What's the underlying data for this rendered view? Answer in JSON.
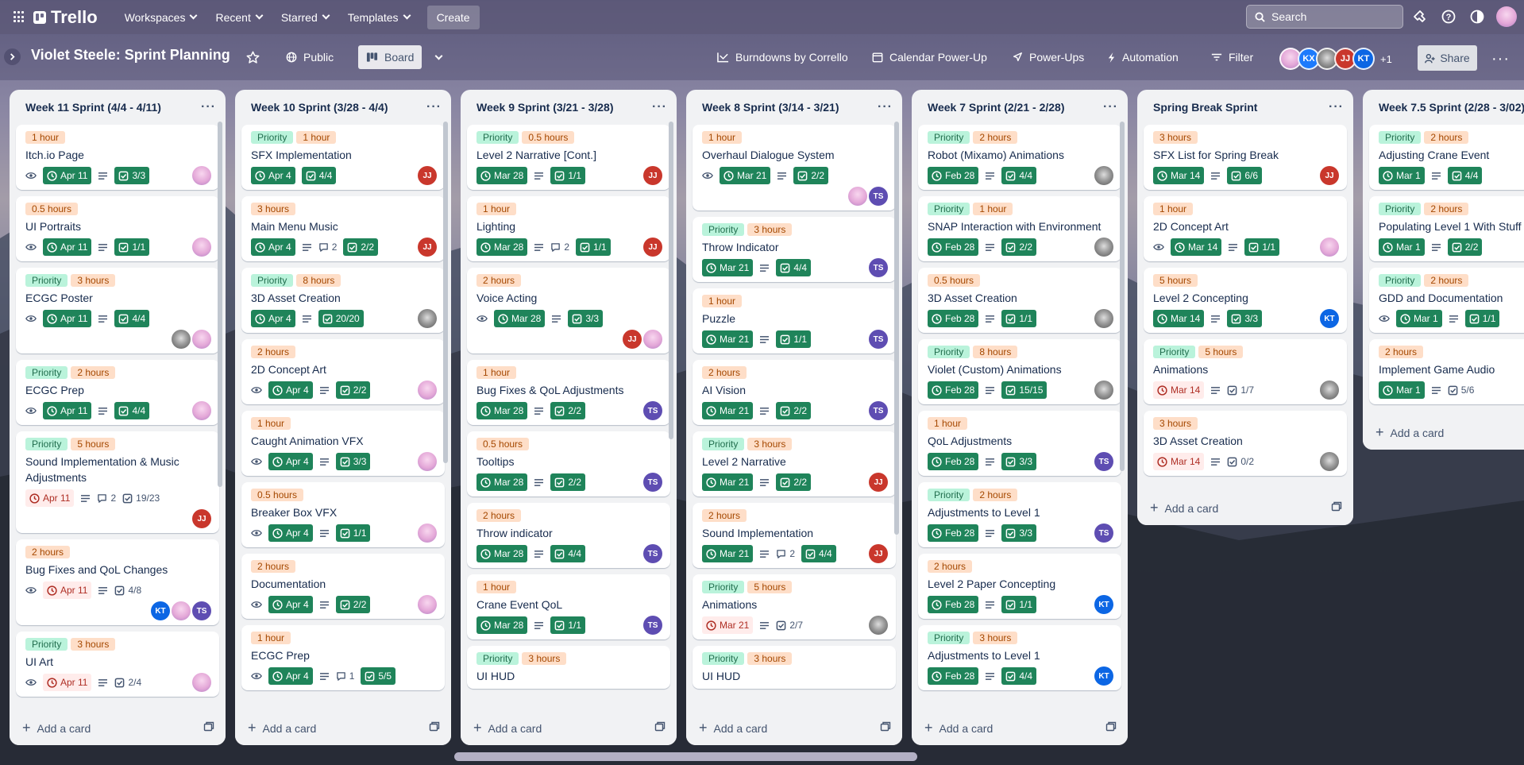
{
  "topbar": {
    "app": "Trello",
    "nav": [
      "Workspaces",
      "Recent",
      "Starred",
      "Templates"
    ],
    "create": "Create",
    "search_placeholder": "Search"
  },
  "board": {
    "title": "Violet Steele: Sprint Planning",
    "visibility": "Public",
    "view": "Board",
    "actions": [
      "Burndowns by Corrello",
      "Calendar Power-Up",
      "Power-Ups",
      "Automation",
      "Filter"
    ],
    "members": [
      "",
      "KX",
      "",
      "JJ",
      "KT"
    ],
    "more_members": "+1",
    "share": "Share"
  },
  "add_card": "Add a card",
  "lists": [
    {
      "title": "Week 11 Sprint (4/4 - 4/11)",
      "cards": [
        {
          "labels": [
            "1 hour"
          ],
          "title": "Itch.io Page",
          "eye": true,
          "date": "Apr 11",
          "date_style": "green",
          "desc": true,
          "check": "3/3",
          "check_style": "green",
          "members": [
            "pk"
          ]
        },
        {
          "labels": [
            "0.5 hours"
          ],
          "title": "UI Portraits",
          "eye": true,
          "date": "Apr 11",
          "date_style": "green",
          "desc": true,
          "check": "1/1",
          "check_style": "green",
          "members": [
            "pk"
          ]
        },
        {
          "labels": [
            "Priority",
            "3 hours"
          ],
          "title": "ECGC Poster",
          "eye": true,
          "date": "Apr 11",
          "date_style": "green",
          "desc": true,
          "check": "4/4",
          "check_style": "green",
          "members": [
            "gr",
            "pk"
          ],
          "members_row": true
        },
        {
          "labels": [
            "Priority",
            "2 hours"
          ],
          "title": "ECGC Prep",
          "eye": true,
          "date": "Apr 11",
          "date_style": "green",
          "desc": true,
          "check": "4/4",
          "check_style": "green",
          "members": [
            "pk"
          ]
        },
        {
          "labels": [
            "Priority",
            "5 hours"
          ],
          "title": "Sound Implementation & Music Adjustments",
          "date": "Apr 11",
          "date_style": "red",
          "desc": true,
          "comments": "2",
          "check": "19/23",
          "members": [
            "jj"
          ],
          "members_row": true
        },
        {
          "labels": [
            "2 hours"
          ],
          "title": "Bug Fixes and QoL Changes",
          "eye": true,
          "date": "Apr 11",
          "date_style": "red",
          "desc": true,
          "check": "4/8",
          "members": [
            "kt",
            "pk",
            "ts"
          ],
          "members_row": true
        },
        {
          "labels": [
            "Priority",
            "3 hours"
          ],
          "title": "UI Art",
          "eye": true,
          "date": "Apr 11",
          "date_style": "red",
          "desc": true,
          "check": "2/4",
          "members": [
            "pk"
          ]
        }
      ]
    },
    {
      "title": "Week 10 Sprint (3/28 - 4/4)",
      "cards": [
        {
          "labels": [
            "Priority",
            "1 hour"
          ],
          "title": "SFX Implementation",
          "date": "Apr 4",
          "date_style": "green",
          "check": "4/4",
          "check_style": "green",
          "members": [
            "jj"
          ]
        },
        {
          "labels": [
            "3 hours"
          ],
          "title": "Main Menu Music",
          "date": "Apr 4",
          "date_style": "green",
          "desc": true,
          "comments": "2",
          "check": "2/2",
          "check_style": "green",
          "members": [
            "jj"
          ]
        },
        {
          "labels": [
            "Priority",
            "8 hours"
          ],
          "title": "3D Asset Creation",
          "date": "Apr 4",
          "date_style": "green",
          "desc": true,
          "check": "20/20",
          "check_style": "green",
          "members": [
            "gr"
          ]
        },
        {
          "labels": [
            "2 hours"
          ],
          "title": "2D Concept Art",
          "eye": true,
          "date": "Apr 4",
          "date_style": "green",
          "desc": true,
          "check": "2/2",
          "check_style": "green",
          "members": [
            "pk"
          ]
        },
        {
          "labels": [
            "1 hour"
          ],
          "title": "Caught Animation VFX",
          "eye": true,
          "date": "Apr 4",
          "date_style": "green",
          "desc": true,
          "check": "3/3",
          "check_style": "green",
          "members": [
            "pk"
          ]
        },
        {
          "labels": [
            "0.5 hours"
          ],
          "title": "Breaker Box VFX",
          "eye": true,
          "date": "Apr 4",
          "date_style": "green",
          "desc": true,
          "check": "1/1",
          "check_style": "green",
          "members": [
            "pk"
          ]
        },
        {
          "labels": [
            "2 hours"
          ],
          "title": "Documentation",
          "eye": true,
          "date": "Apr 4",
          "date_style": "green",
          "desc": true,
          "check": "2/2",
          "check_style": "green",
          "members": [
            "pk"
          ]
        },
        {
          "labels": [
            "1 hour"
          ],
          "title": "ECGC Prep",
          "eye": true,
          "date": "Apr 4",
          "date_style": "green",
          "desc": true,
          "comments": "1",
          "check": "5/5",
          "check_style": "green",
          "members": []
        }
      ]
    },
    {
      "title": "Week 9 Sprint (3/21 - 3/28)",
      "cards": [
        {
          "labels": [
            "Priority",
            "0.5 hours"
          ],
          "title": "Level 2 Narrative [Cont.]",
          "date": "Mar 28",
          "date_style": "green",
          "desc": true,
          "check": "1/1",
          "check_style": "green",
          "members": [
            "jj"
          ]
        },
        {
          "labels": [
            "1 hour"
          ],
          "title": "Lighting",
          "date": "Mar 28",
          "date_style": "green",
          "desc": true,
          "comments": "2",
          "check": "1/1",
          "check_style": "green",
          "members": [
            "jj"
          ]
        },
        {
          "labels": [
            "2 hours"
          ],
          "title": "Voice Acting",
          "eye": true,
          "date": "Mar 28",
          "date_style": "green",
          "desc": true,
          "check": "3/3",
          "check_style": "green",
          "members": [
            "jj",
            "pk"
          ],
          "members_row": true
        },
        {
          "labels": [
            "1 hour"
          ],
          "title": "Bug Fixes & QoL Adjustments",
          "date": "Mar 28",
          "date_style": "green",
          "desc": true,
          "check": "2/2",
          "check_style": "green",
          "members": [
            "ts"
          ]
        },
        {
          "labels": [
            "0.5 hours"
          ],
          "title": "Tooltips",
          "date": "Mar 28",
          "date_style": "green",
          "desc": true,
          "check": "2/2",
          "check_style": "green",
          "members": [
            "ts"
          ]
        },
        {
          "labels": [
            "2 hours"
          ],
          "title": "Throw indicator",
          "date": "Mar 28",
          "date_style": "green",
          "desc": true,
          "check": "4/4",
          "check_style": "green",
          "members": [
            "ts"
          ]
        },
        {
          "labels": [
            "1 hour"
          ],
          "title": "Crane Event QoL",
          "date": "Mar 28",
          "date_style": "green",
          "desc": true,
          "check": "1/1",
          "check_style": "green",
          "members": [
            "ts"
          ]
        },
        {
          "labels": [
            "Priority",
            "3 hours"
          ],
          "title": "UI HUD",
          "members": []
        }
      ]
    },
    {
      "title": "Week 8 Sprint (3/14 - 3/21)",
      "cards": [
        {
          "labels": [
            "1 hour"
          ],
          "title": "Overhaul Dialogue System",
          "eye": true,
          "date": "Mar 21",
          "date_style": "green",
          "desc": true,
          "check": "2/2",
          "check_style": "green",
          "members": [
            "pk",
            "ts"
          ],
          "members_row": true
        },
        {
          "labels": [
            "Priority",
            "3 hours"
          ],
          "title": "Throw Indicator",
          "date": "Mar 21",
          "date_style": "green",
          "desc": true,
          "check": "4/4",
          "check_style": "green",
          "members": [
            "ts"
          ]
        },
        {
          "labels": [
            "1 hour"
          ],
          "title": "Puzzle",
          "date": "Mar 21",
          "date_style": "green",
          "desc": true,
          "check": "1/1",
          "check_style": "green",
          "members": [
            "ts"
          ]
        },
        {
          "labels": [
            "2 hours"
          ],
          "title": "AI Vision",
          "date": "Mar 21",
          "date_style": "green",
          "desc": true,
          "check": "2/2",
          "check_style": "green",
          "members": [
            "ts"
          ]
        },
        {
          "labels": [
            "Priority",
            "3 hours"
          ],
          "title": "Level 2 Narrative",
          "date": "Mar 21",
          "date_style": "green",
          "desc": true,
          "check": "2/2",
          "check_style": "green",
          "members": [
            "jj"
          ]
        },
        {
          "labels": [
            "2 hours"
          ],
          "title": "Sound Implementation",
          "date": "Mar 21",
          "date_style": "green",
          "desc": true,
          "comments": "2",
          "check": "4/4",
          "check_style": "green",
          "members": [
            "jj"
          ]
        },
        {
          "labels": [
            "Priority",
            "5 hours"
          ],
          "title": "Animations",
          "date": "Mar 21",
          "date_style": "red",
          "desc": true,
          "check": "2/7",
          "members": [
            "gr"
          ]
        },
        {
          "labels": [
            "Priority",
            "3 hours"
          ],
          "title": "UI HUD",
          "members": []
        }
      ]
    },
    {
      "title": "Week 7 Sprint (2/21 - 2/28)",
      "cards": [
        {
          "labels": [
            "Priority",
            "2 hours"
          ],
          "title": "Robot (Mixamo) Animations",
          "date": "Feb 28",
          "date_style": "green",
          "desc": true,
          "check": "4/4",
          "check_style": "green",
          "members": [
            "gr"
          ]
        },
        {
          "labels": [
            "Priority",
            "1 hour"
          ],
          "title": "SNAP Interaction with Environment",
          "date": "Feb 28",
          "date_style": "green",
          "desc": true,
          "check": "2/2",
          "check_style": "green",
          "members": [
            "gr"
          ]
        },
        {
          "labels": [
            "0.5 hours"
          ],
          "title": "3D Asset Creation",
          "date": "Feb 28",
          "date_style": "green",
          "desc": true,
          "check": "1/1",
          "check_style": "green",
          "members": [
            "gr"
          ]
        },
        {
          "labels": [
            "Priority",
            "8 hours"
          ],
          "title": "Violet (Custom) Animations",
          "date": "Feb 28",
          "date_style": "green",
          "desc": true,
          "check": "15/15",
          "check_style": "green",
          "members": [
            "gr"
          ]
        },
        {
          "labels": [
            "1 hour"
          ],
          "title": "QoL Adjustments",
          "date": "Feb 28",
          "date_style": "green",
          "desc": true,
          "check": "3/3",
          "check_style": "green",
          "members": [
            "ts"
          ]
        },
        {
          "labels": [
            "Priority",
            "2 hours"
          ],
          "title": "Adjustments to Level 1",
          "date": "Feb 28",
          "date_style": "green",
          "desc": true,
          "check": "3/3",
          "check_style": "green",
          "members": [
            "ts"
          ]
        },
        {
          "labels": [
            "2 hours"
          ],
          "title": "Level 2 Paper Concepting",
          "date": "Feb 28",
          "date_style": "green",
          "desc": true,
          "check": "1/1",
          "check_style": "green",
          "members": [
            "kt"
          ]
        },
        {
          "labels": [
            "Priority",
            "3 hours"
          ],
          "title": "Adjustments to Level 1",
          "date": "Feb 28",
          "date_style": "green",
          "desc": true,
          "check": "4/4",
          "check_style": "green",
          "members": [
            "kt"
          ]
        }
      ]
    },
    {
      "title": "Spring Break Sprint",
      "cards": [
        {
          "labels": [
            "3 hours"
          ],
          "title": "SFX List for Spring Break",
          "date": "Mar 14",
          "date_style": "green",
          "desc": true,
          "check": "6/6",
          "check_style": "green",
          "members": [
            "jj"
          ]
        },
        {
          "labels": [
            "1 hour"
          ],
          "title": "2D Concept Art",
          "eye": true,
          "date": "Mar 14",
          "date_style": "green",
          "desc": true,
          "check": "1/1",
          "check_style": "green",
          "members": [
            "pk"
          ]
        },
        {
          "labels": [
            "5 hours"
          ],
          "title": "Level 2 Concepting",
          "date": "Mar 14",
          "date_style": "green",
          "desc": true,
          "check": "3/3",
          "check_style": "green",
          "members": [
            "kt"
          ]
        },
        {
          "labels": [
            "Priority",
            "5 hours"
          ],
          "title": "Animations",
          "date": "Mar 14",
          "date_style": "red",
          "desc": true,
          "check": "1/7",
          "members": [
            "gr"
          ]
        },
        {
          "labels": [
            "3 hours"
          ],
          "title": "3D Asset Creation",
          "date": "Mar 14",
          "date_style": "red",
          "desc": true,
          "check": "0/2",
          "members": [
            "gr"
          ]
        }
      ]
    },
    {
      "title": "Week 7.5 Sprint (2/28 - 3/02)",
      "cards": [
        {
          "labels": [
            "Priority",
            "2 hours"
          ],
          "title": "Adjusting Crane Event",
          "date": "Mar 1",
          "date_style": "green",
          "desc": true,
          "check": "4/4",
          "check_style": "green",
          "members": []
        },
        {
          "labels": [
            "Priority",
            "2 hours"
          ],
          "title": "Populating Level 1 With Stuff",
          "date": "Mar 1",
          "date_style": "green",
          "desc": true,
          "check": "2/2",
          "check_style": "green",
          "members": []
        },
        {
          "labels": [
            "Priority",
            "2 hours"
          ],
          "title": "GDD and Documentation",
          "eye": true,
          "date": "Mar 1",
          "date_style": "green",
          "desc": true,
          "check": "1/1",
          "check_style": "green",
          "members": []
        },
        {
          "labels": [
            "2 hours"
          ],
          "title": "Implement Game Audio",
          "date": "Mar 1",
          "date_style": "green",
          "desc": true,
          "check": "5/6",
          "members": []
        }
      ]
    }
  ]
}
